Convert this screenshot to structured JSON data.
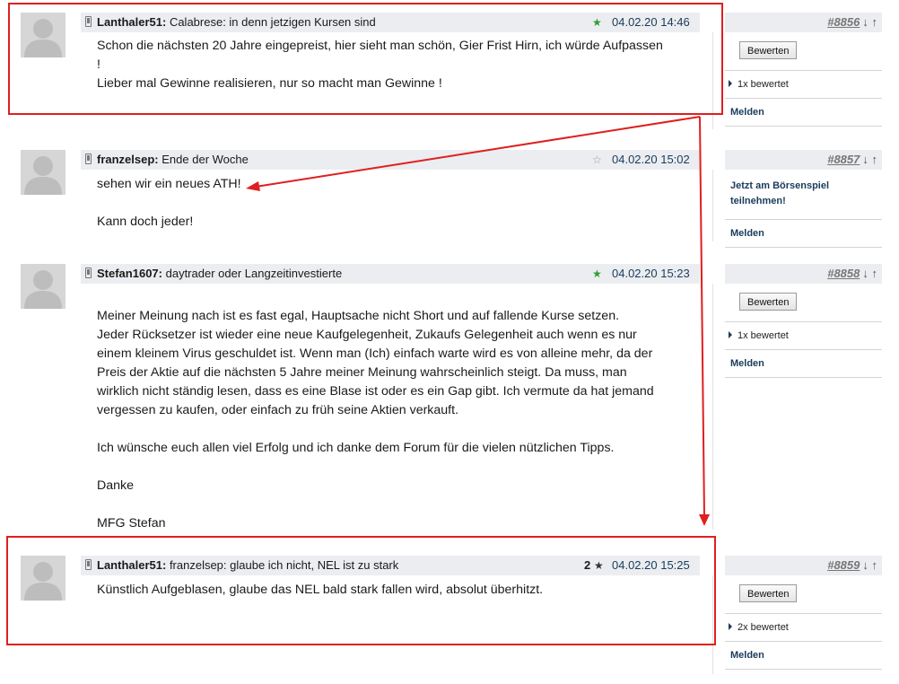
{
  "posts": [
    {
      "user": "Lanthaler51:",
      "subject": "Calabrese: in denn jetzigen Kursen sind",
      "star": "★",
      "star_color": "#2e9e2e",
      "count": "",
      "time": "04.02.20 14:46",
      "number": "#8856",
      "arrows": "↓ ↑",
      "text": "Schon die nächsten 20 Jahre eingepreist,  hier sieht man schön, Gier Frist Hirn,  ich würde Aufpassen\n!\nLieber mal Gewinne realisieren,  nur so macht man Gewinne !",
      "side": {
        "button": "Bewerten",
        "rated": "1x bewertet",
        "report": "Melden"
      }
    },
    {
      "user": "franzelsep:",
      "subject": "Ende der Woche",
      "star": "☆",
      "star_color": "#999999",
      "count": "",
      "time": "04.02.20 15:02",
      "number": "#8857",
      "arrows": "↓ ↑",
      "text": "sehen wir ein neues ATH!\n\nKann doch jeder!",
      "side": {
        "join": "Jetzt am Börsenspiel teilnehmen!",
        "report": "Melden"
      }
    },
    {
      "user": "Stefan1607:",
      "subject": "daytrader oder Langzeitinvestierte",
      "star": "★",
      "star_color": "#2e9e2e",
      "count": "",
      "time": "04.02.20 15:23",
      "number": "#8858",
      "arrows": "↓ ↑",
      "text": "Meiner Meinung nach ist es fast egal, Hauptsache nicht Short und auf fallende Kurse setzen.\nJeder Rücksetzer ist wieder eine neue Kaufgelegenheit, Zukaufs Gelegenheit auch wenn es nur\neinem kleinem Virus geschuldet ist. Wenn man (Ich) einfach warte wird es von alleine mehr, da der\nPreis der Aktie auf die nächsten 5 Jahre meiner Meinung wahrscheinlich steigt. Da muss, man\nwirklich nicht ständig lesen, dass es eine Blase ist oder es ein Gap gibt. Ich vermute da hat jemand\nvergessen zu kaufen, oder einfach zu früh seine Aktien verkauft.\n\nIch wünsche euch allen viel Erfolg und ich danke dem Forum für die vielen nützlichen Tipps.\n\nDanke\n\nMFG Stefan",
      "side": {
        "button": "Bewerten",
        "rated": "1x bewertet",
        "report": "Melden"
      }
    },
    {
      "user": "Lanthaler51:",
      "subject": "franzelsep: glaube ich nicht, NEL ist zu stark",
      "star": "★",
      "star_color": "#333333",
      "count": "2",
      "time": "04.02.20 15:25",
      "number": "#8859",
      "arrows": "↓ ↑",
      "text": "Künstlich Aufgeblasen,  glaube das NEL bald stark fallen wird,  absolut überhitzt.",
      "side": {
        "button": "Bewerten",
        "rated": "2x bewertet",
        "report": "Melden"
      }
    }
  ],
  "colors": {
    "annotation": "#e01f1f",
    "header_bg": "#ebedf0",
    "link": "#1a3b5c"
  }
}
